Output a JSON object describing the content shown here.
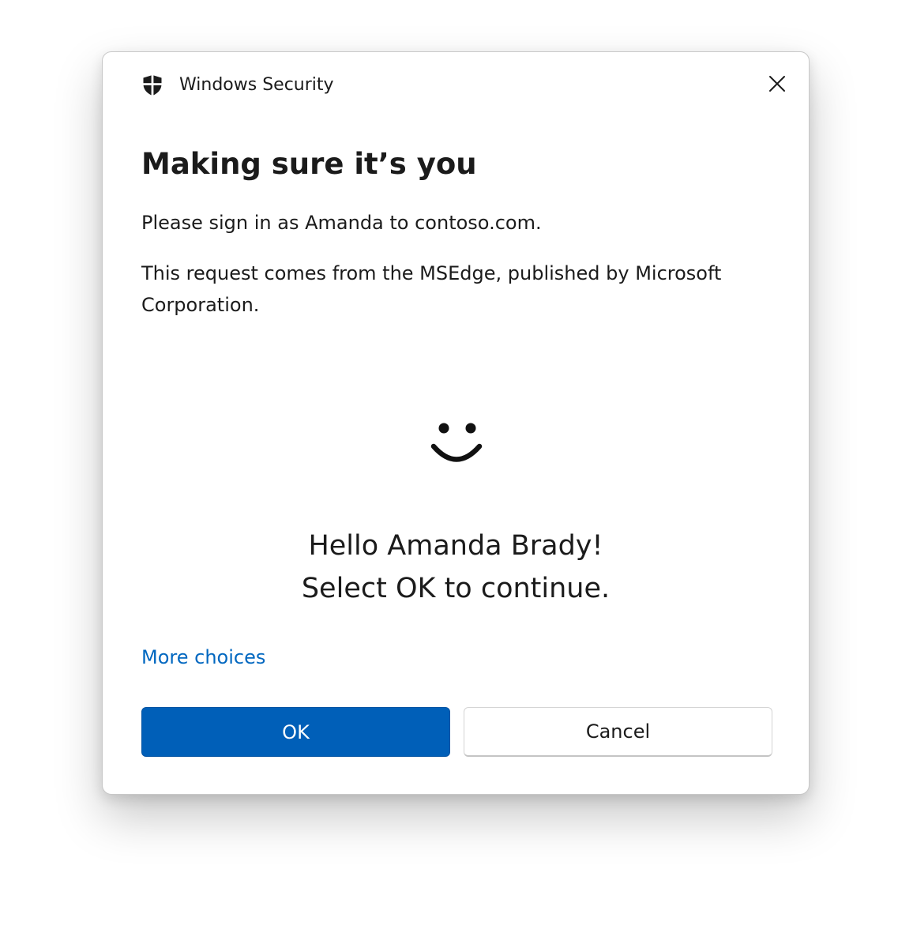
{
  "window": {
    "app_title": "Windows Security",
    "title_icon": "shield-icon",
    "close_icon": "close-icon"
  },
  "content": {
    "heading": "Making sure it’s you",
    "sign_in_prompt": "Please sign in as Amanda to contoso.com.",
    "request_source": "This request comes from the MSEdge, published by Microsoft Corporation.",
    "face_icon": "windows-hello-face-icon",
    "greeting_line1": "Hello Amanda Brady!",
    "greeting_line2": "Select OK to continue."
  },
  "links": {
    "more_choices": "More choices"
  },
  "buttons": {
    "ok": "OK",
    "cancel": "Cancel"
  },
  "colors": {
    "accent": "#005fb8",
    "link": "#0067c0",
    "text": "#1b1b1b"
  }
}
